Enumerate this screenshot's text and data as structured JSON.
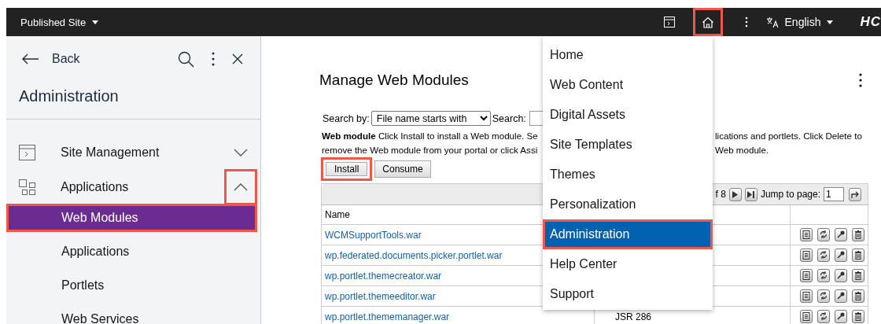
{
  "topbar": {
    "site_switcher": "Published Site",
    "home_highlighted": true,
    "language": "English",
    "logo": "HC"
  },
  "sidebar": {
    "back": "Back",
    "title": "Administration",
    "items": [
      {
        "label": "Site Management",
        "expanded": false,
        "highlighted": false
      },
      {
        "label": "Applications",
        "expanded": true,
        "highlighted": true,
        "children": [
          {
            "label": "Web Modules",
            "selected": true,
            "highlighted": true
          },
          {
            "label": "Applications",
            "selected": false,
            "highlighted": false
          },
          {
            "label": "Portlets",
            "selected": false,
            "highlighted": false
          },
          {
            "label": "Web Services",
            "selected": false,
            "highlighted": false
          }
        ]
      }
    ]
  },
  "main": {
    "title": "Manage Web Modules",
    "search_by_label": "Search by:",
    "search_by_value": "File name starts with",
    "search_label": "Search:",
    "description": {
      "left_lines": [
        "**Web module**  Click Install to install a Web module. Se",
        "remove the Web module from your portal or click Assi"
      ],
      "right_lines": [
        "lications and portlets. Click Delete to",
        "Web module."
      ]
    },
    "buttons": [
      {
        "label": "Install",
        "highlighted": true
      },
      {
        "label": "Consume",
        "highlighted": false
      }
    ],
    "table": {
      "pager": {
        "page_of": "f 8",
        "jump_label": "Jump to page:",
        "jump_value": "1"
      },
      "columns": [
        "Name"
      ],
      "rows": [
        {
          "name": "WCMSupportTools.war"
        },
        {
          "name": "wp.federated.documents.picker.portlet.war"
        },
        {
          "name": "wp.portlet.themecreator.war"
        },
        {
          "name": "wp.portlet.themeeditor.war"
        },
        {
          "name": "wp.portlet.thememanager.war",
          "column_2": "JSR 286"
        }
      ]
    }
  },
  "menu": {
    "items": [
      {
        "label": "Home",
        "selected": false,
        "highlighted": false
      },
      {
        "label": "Web Content",
        "selected": false,
        "highlighted": false
      },
      {
        "label": "Digital Assets",
        "selected": false,
        "highlighted": false
      },
      {
        "label": "Site Templates",
        "selected": false,
        "highlighted": false
      },
      {
        "label": "Themes",
        "selected": false,
        "highlighted": false
      },
      {
        "label": "Personalization",
        "selected": false,
        "highlighted": false
      },
      {
        "label": "Administration",
        "selected": true,
        "highlighted": true
      },
      {
        "label": "Help Center",
        "selected": false,
        "highlighted": false
      },
      {
        "label": "Support",
        "selected": false,
        "highlighted": false
      }
    ]
  }
}
